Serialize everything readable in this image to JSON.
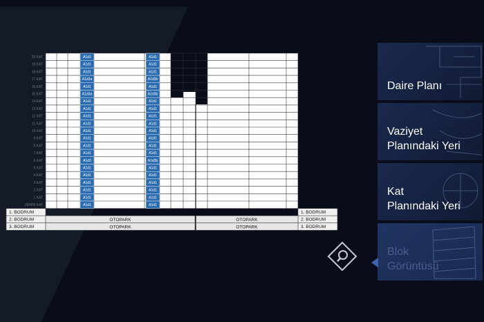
{
  "menu": {
    "items": [
      {
        "label": "Daire Planı",
        "active": false
      },
      {
        "label": "Vaziyet\nPlanındaki Yeri",
        "active": false
      },
      {
        "label": "Kat\nPlanındaki Yeri",
        "active": false
      },
      {
        "label": "Blok\nGörüntüsü",
        "active": true
      }
    ]
  },
  "building": {
    "floors": [
      "20.KAT",
      "19.KAT",
      "18.KAT",
      "17.KAT",
      "16.KAT",
      "15.KAT",
      "14.KAT",
      "13.KAT",
      "12.KAT",
      "11.KAT",
      "10.KAT",
      "9.KAT",
      "8.KAT",
      "7.KAT",
      "6.KAT",
      "5.KAT",
      "4.KAT",
      "3.KAT",
      "2.KAT",
      "1.KAT",
      "ZEMİN KAT"
    ],
    "unit_labels_left": [
      "A1d1",
      "A1d1",
      "A1d1",
      "A1d3a",
      "A1d1",
      "A1d3a",
      "A1d1",
      "A1d1",
      "A1d1",
      "A1d1",
      "A1d1",
      "A1d1",
      "A1d1",
      "A1d1",
      "A1d3",
      "A1d1",
      "A1d1",
      "A1d1",
      "A1d1",
      "A1d1",
      "A1d1"
    ],
    "unit_labels_right": [
      "A1d1",
      "A1d1",
      "A1d1",
      "A1d3b",
      "A1d1",
      "A1d3b",
      "A1d1",
      "A1d1",
      "A1d1",
      "A1d1",
      "A1d1",
      "A1d1",
      "A1d1",
      "A1d1",
      "A1d3b",
      "A1d1",
      "A1d1",
      "A1d1",
      "A1d1",
      "A1d1",
      "A1d1"
    ],
    "basement_left": [
      "1. BODRUM",
      "2. BODRUM",
      "3. BODRUM"
    ],
    "basement_right": [
      "1. BODRUM",
      "2. BODRUM",
      "3. BODRUM"
    ],
    "parking_label": "OTOPARK"
  },
  "colors": {
    "highlight": "#2b6cb0",
    "background": "#0a0e1c",
    "panel": "#14213f"
  },
  "icons": {
    "zoom": "magnifier-diamond-icon",
    "active_indicator": "triangle-left-icon"
  }
}
